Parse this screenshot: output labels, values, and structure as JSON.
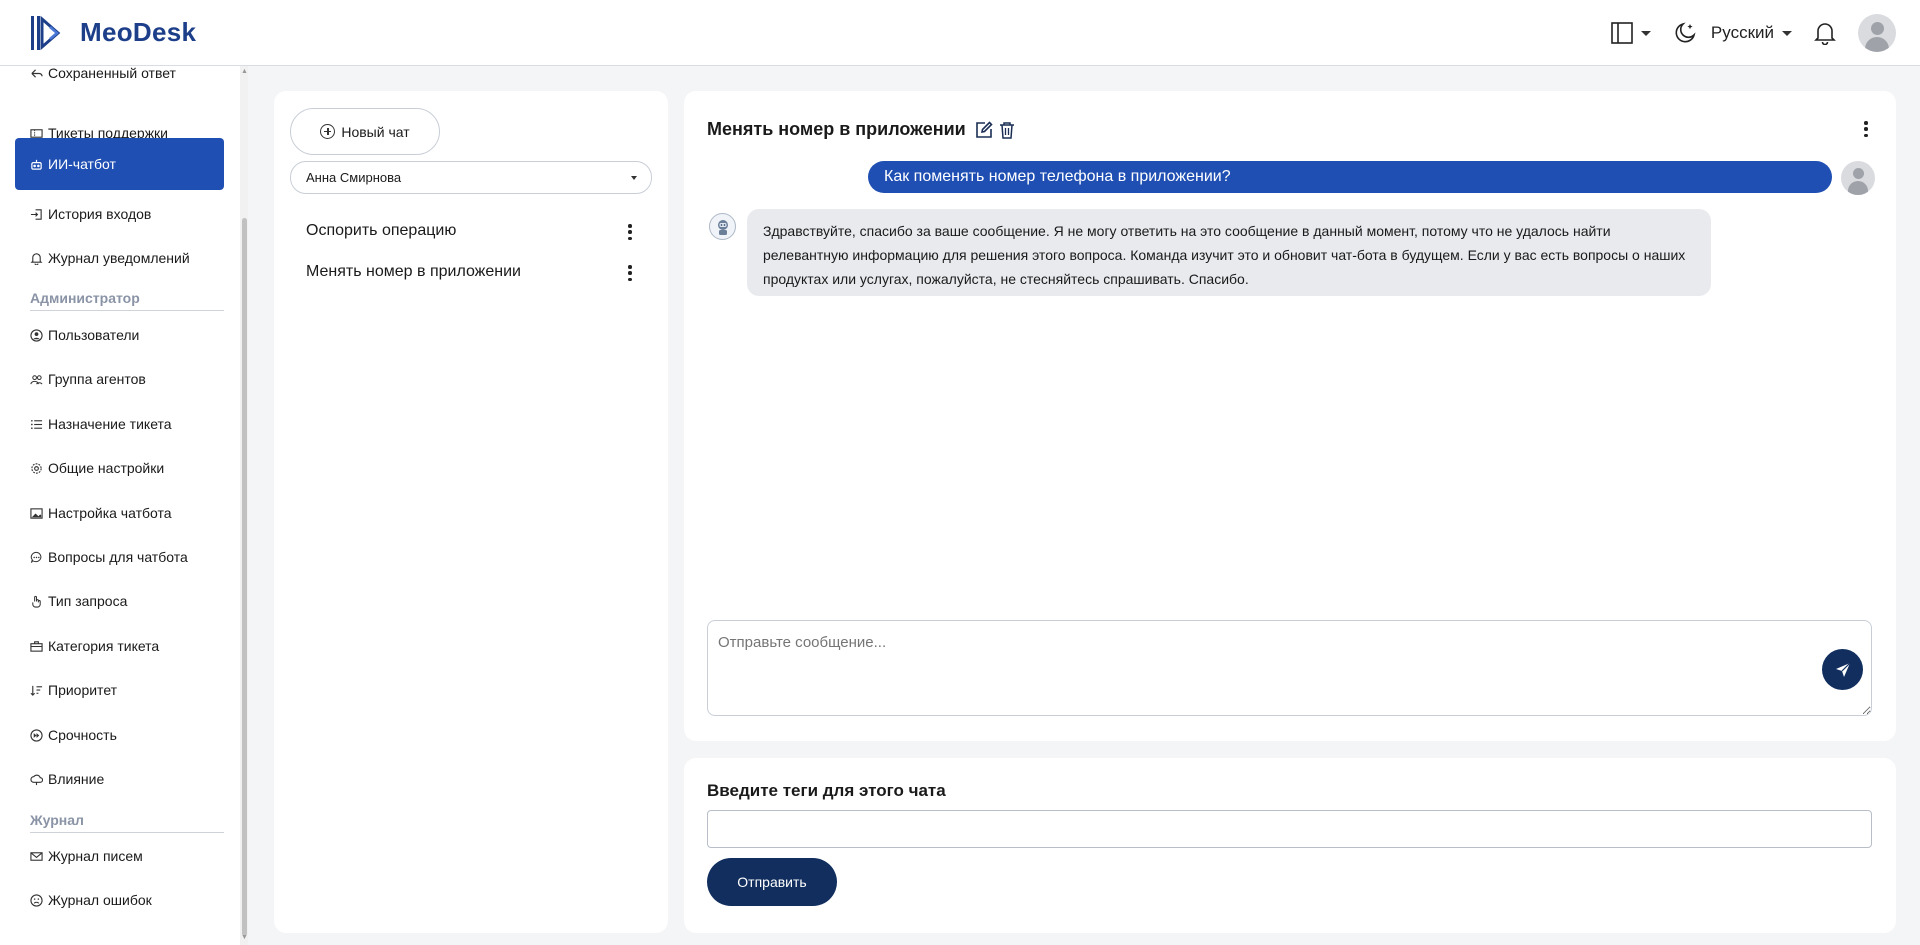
{
  "app": {
    "name": "MeoDesk"
  },
  "header": {
    "language": "Русский"
  },
  "sidebar": {
    "items": [
      {
        "label": "Сохраненный ответ",
        "icon": "saved-reply-icon"
      },
      {
        "label": "Тикеты поддержки",
        "icon": "ticket-icon"
      },
      {
        "label": "ИИ-чатбот",
        "icon": "bot-icon",
        "active": true
      },
      {
        "label": "История входов",
        "icon": "login-history-icon"
      },
      {
        "label": "Журнал уведомлений",
        "icon": "bell-icon"
      }
    ],
    "section_admin": "Администратор",
    "admin_items": [
      {
        "label": "Пользователи",
        "icon": "user-circle-icon"
      },
      {
        "label": "Группа агентов",
        "icon": "users-icon"
      },
      {
        "label": "Назначение тикета",
        "icon": "list-icon"
      },
      {
        "label": "Общие настройки",
        "icon": "gear-icon"
      },
      {
        "label": "Настройка чатбота",
        "icon": "image-icon"
      },
      {
        "label": "Вопросы для чатбота",
        "icon": "chat-dots-icon"
      },
      {
        "label": "Тип запроса",
        "icon": "pointer-icon"
      },
      {
        "label": "Категория тикета",
        "icon": "briefcase-icon"
      },
      {
        "label": "Приоритет",
        "icon": "sort-icon"
      },
      {
        "label": "Срочность",
        "icon": "fast-forward-icon"
      },
      {
        "label": "Влияние",
        "icon": "cloud-icon"
      }
    ],
    "section_log": "Журнал",
    "log_items": [
      {
        "label": "Журнал писем",
        "icon": "envelope-icon"
      },
      {
        "label": "Журнал ошибок",
        "icon": "sad-face-icon"
      }
    ]
  },
  "chat_list": {
    "new_chat_label": "Новый чат",
    "selected_user": "Анна Смирнова",
    "chats": [
      {
        "title": "Оспорить операцию"
      },
      {
        "title": "Менять номер в приложении"
      }
    ]
  },
  "chat": {
    "title": "Менять номер в приложении",
    "user_message": "Как поменять номер телефона в приложении?",
    "bot_message": "Здравствуйте, спасибо за ваше сообщение. Я не могу ответить на это сообщение в данный момент, потому что не удалось найти релевантную информацию для решения этого вопроса. Команда изучит это и обновит чат-бота в будущем. Если у вас есть вопросы о наших продуктах или услугах, пожалуйста, не стесняйтесь спрашивать. Спасибо.",
    "input_placeholder": "Отправьте сообщение..."
  },
  "tags": {
    "title": "Введите теги для этого чата",
    "submit_label": "Отправить"
  },
  "colors": {
    "accent": "#1f4fb3",
    "dark_button": "#112e5e",
    "brand": "#1d3f8a"
  }
}
